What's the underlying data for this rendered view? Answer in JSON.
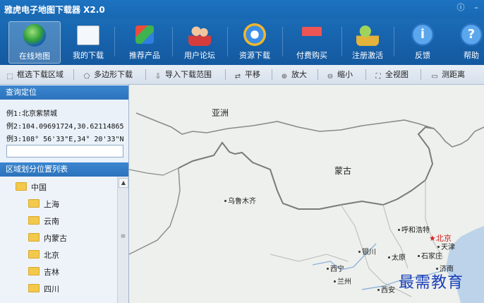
{
  "app": {
    "title": "雅虎电子地图下载器 X2.0"
  },
  "ribbon": {
    "items": [
      {
        "label": "在线地图",
        "icon": "globe-icon"
      },
      {
        "label": "我的下载",
        "icon": "document-list-icon"
      },
      {
        "label": "推荐产品",
        "icon": "cubes-icon"
      },
      {
        "label": "用户论坛",
        "icon": "users-icon"
      },
      {
        "label": "资源下载",
        "icon": "ie-download-icon"
      },
      {
        "label": "付费购买",
        "icon": "shopping-cart-icon"
      },
      {
        "label": "注册激活",
        "icon": "lock-user-icon"
      },
      {
        "label": "反馈",
        "icon": "info-icon"
      },
      {
        "label": "帮助",
        "icon": "help-icon"
      }
    ]
  },
  "toolbar": {
    "items": [
      {
        "label": "框选下载区域",
        "icon": "select-rect-icon"
      },
      {
        "label": "多边形下载",
        "icon": "polygon-icon"
      },
      {
        "label": "导入下载范围",
        "icon": "import-icon"
      },
      {
        "label": "平移",
        "icon": "pan-icon"
      },
      {
        "label": "放大",
        "icon": "zoom-in-icon"
      },
      {
        "label": "缩小",
        "icon": "zoom-out-icon"
      },
      {
        "label": "全视图",
        "icon": "full-view-icon"
      },
      {
        "label": "测距离",
        "icon": "ruler-icon"
      }
    ]
  },
  "query": {
    "title": "查询定位",
    "examples": [
      "例1:北京紫禁城",
      "例2:104.09691724,30.62114865",
      "例3:108° 56'33\"E,34° 20'33\"N"
    ],
    "search_value": ""
  },
  "regions": {
    "title": "区域划分位置列表",
    "root": "中国",
    "children": [
      "上海",
      "云南",
      "内蒙古",
      "北京",
      "吉林",
      "四川"
    ]
  },
  "map": {
    "labels": {
      "asia": "亚洲",
      "mongolia": "蒙古",
      "urumqi": "乌鲁木齐",
      "hohhot": "呼和浩特",
      "beijing": "北京",
      "tianjin": "天津",
      "yinchuan": "银川",
      "taiyuan": "太原",
      "shijiazhuang": "石家庄",
      "xining": "西宁",
      "lanzhou": "兰州",
      "jinan": "济南",
      "xian": "西安"
    }
  },
  "watermark": "最需教育",
  "colors": {
    "ribbon": "#1565b0",
    "panel_head": "#3380c8",
    "capital": "#d02020",
    "watermark": "#1b3fb8"
  }
}
